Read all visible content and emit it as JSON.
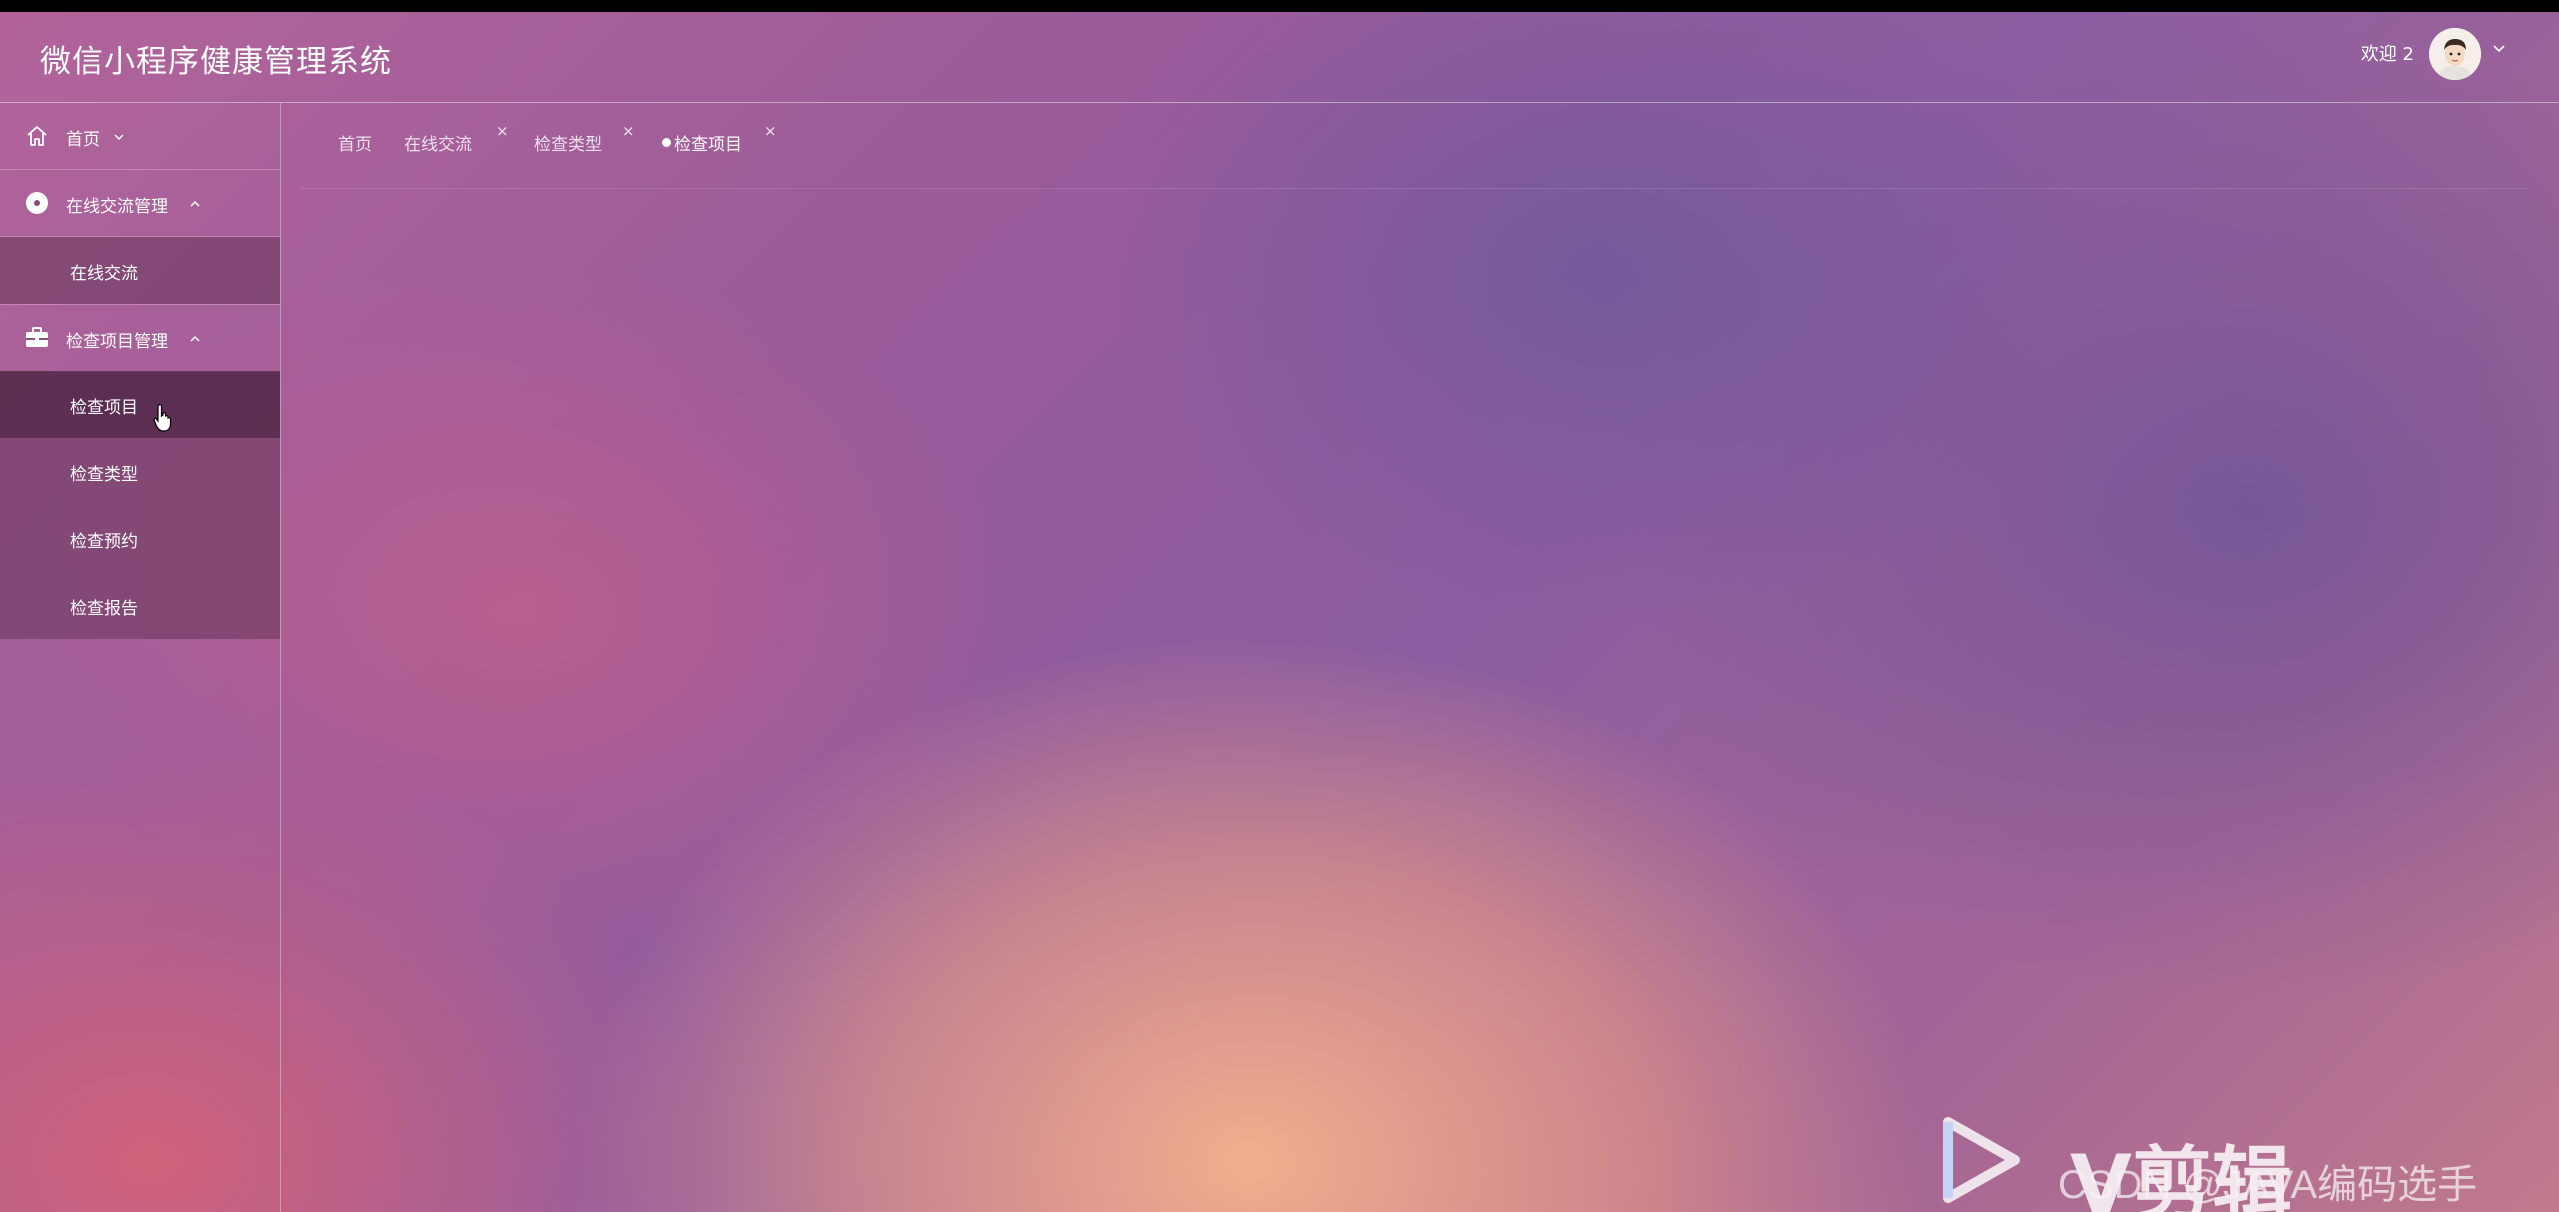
{
  "header": {
    "title": "微信小程序健康管理系统",
    "welcome": "欢迎 2"
  },
  "sidebar": {
    "menus": [
      {
        "label": "首页",
        "icon": "home-icon",
        "expanded": false
      },
      {
        "label": "在线交流管理",
        "icon": "disc-icon",
        "expanded": true,
        "items": [
          "在线交流"
        ]
      },
      {
        "label": "检查项目管理",
        "icon": "briefcase-icon",
        "expanded": true,
        "items": [
          "检查项目",
          "检查类型",
          "检查预约",
          "检查报告"
        ],
        "active_item": "检查项目"
      }
    ]
  },
  "tabs": [
    {
      "label": "首页",
      "closable": false
    },
    {
      "label": "在线交流",
      "closable": true
    },
    {
      "label": "检查类型",
      "closable": true
    },
    {
      "label": "检查项目",
      "closable": true,
      "active": true
    }
  ],
  "watermark": {
    "csdn": "CSDN @JAVA编码选手",
    "brand": "V剪辑"
  },
  "colors": {
    "text": "#ffffff",
    "active_bg": "#3c1937"
  }
}
